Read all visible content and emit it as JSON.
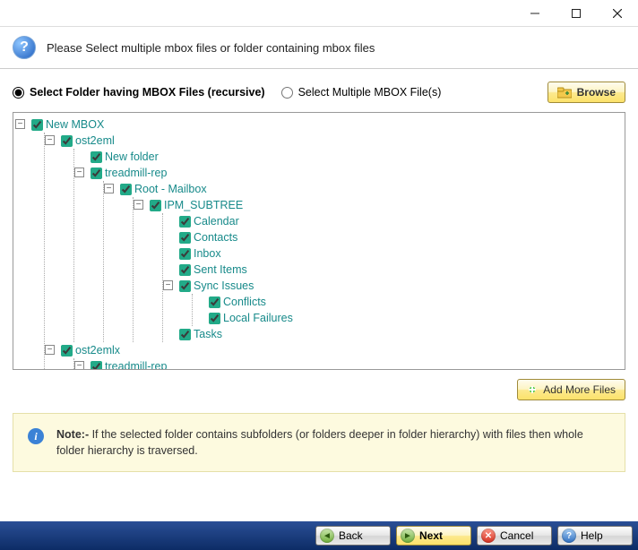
{
  "titlebar": {
    "min": "minimize",
    "max": "maximize",
    "close": "close"
  },
  "header": {
    "text": "Please Select multiple mbox files or folder containing mbox files"
  },
  "options": {
    "folder_label": "Select Folder having MBOX Files (recursive)",
    "multiple_label": "Select Multiple MBOX File(s)",
    "selected": "folder",
    "browse_label": "Browse"
  },
  "tree": {
    "root": {
      "label": "New MBOX"
    },
    "ost2eml": {
      "label": "ost2eml"
    },
    "new_folder": {
      "label": "New folder"
    },
    "treadmill_rep": {
      "label": "treadmill-rep"
    },
    "root_mailbox": {
      "label": "Root - Mailbox"
    },
    "ipm_subtree": {
      "label": "IPM_SUBTREE"
    },
    "calendar": {
      "label": "Calendar"
    },
    "contacts": {
      "label": "Contacts"
    },
    "inbox": {
      "label": "Inbox"
    },
    "sent_items": {
      "label": "Sent Items"
    },
    "sync_issues": {
      "label": "Sync Issues"
    },
    "conflicts": {
      "label": "Conflicts"
    },
    "local_failures": {
      "label": "Local Failures"
    },
    "tasks": {
      "label": "Tasks"
    },
    "ost2emlx": {
      "label": "ost2emlx"
    },
    "treadmill_rep2": {
      "label": "treadmill-rep"
    }
  },
  "add_more_label": "Add More Files",
  "note": {
    "lead": "Note:- ",
    "body": "If the selected folder contains subfolders (or folders deeper in folder hierarchy) with files then whole folder hierarchy is traversed."
  },
  "footer": {
    "back": "Back",
    "next": "Next",
    "cancel": "Cancel",
    "help": "Help"
  }
}
